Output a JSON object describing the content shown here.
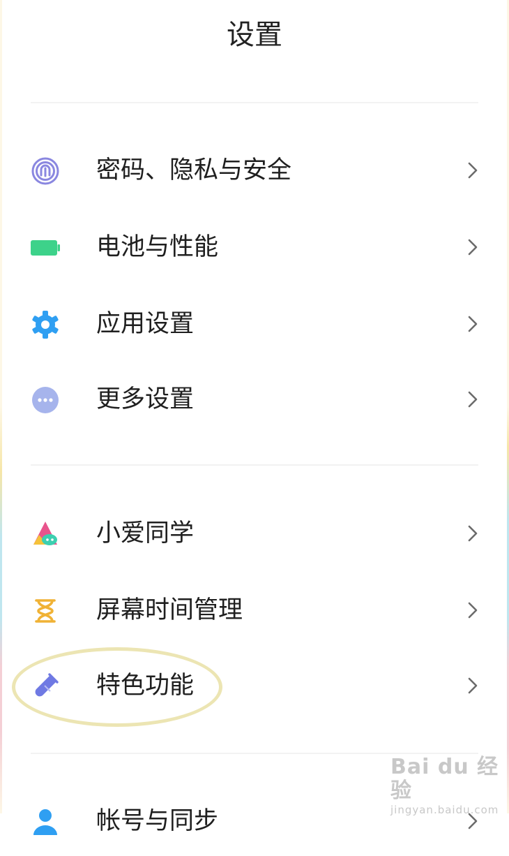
{
  "header": {
    "title": "设置"
  },
  "groups": [
    {
      "items": [
        {
          "label": "密码、隐私与安全",
          "icon": "fingerprint-icon",
          "color": "#8a87e0"
        },
        {
          "label": "电池与性能",
          "icon": "battery-icon",
          "color": "#3dd28a"
        },
        {
          "label": "应用设置",
          "icon": "gear-icon",
          "color": "#2f9ff2"
        },
        {
          "label": "更多设置",
          "icon": "more-dots-icon",
          "color": "#a6b4ec"
        }
      ]
    },
    {
      "items": [
        {
          "label": "小爱同学",
          "icon": "xiaoai-icon",
          "color": "#e8548c"
        },
        {
          "label": "屏幕时间管理",
          "icon": "hourglass-icon",
          "color": "#f0b235"
        },
        {
          "label": "特色功能",
          "icon": "test-tube-icon",
          "color": "#6f79e3"
        }
      ]
    },
    {
      "items": [
        {
          "label": "帐号与同步",
          "icon": "account-icon",
          "color": "#2f9ff2"
        }
      ]
    }
  ],
  "watermark": {
    "top": "Bai du 经验",
    "bottom": "jingyan.baidu.com"
  }
}
